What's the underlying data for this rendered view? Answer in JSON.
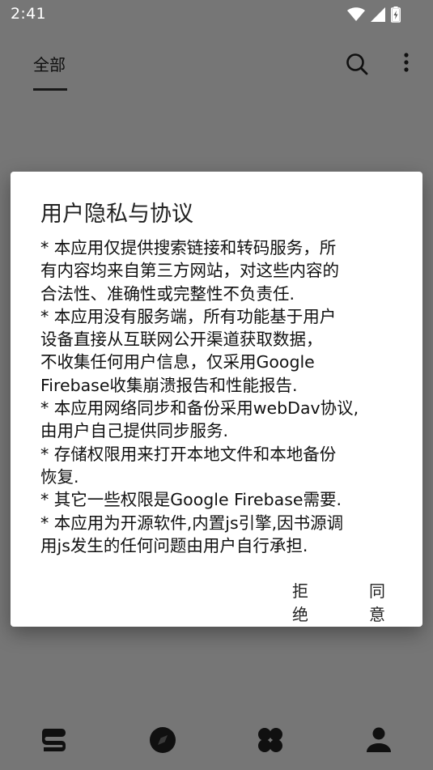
{
  "status_bar": {
    "time": "2:41",
    "icons": [
      "wifi-icon",
      "signal-icon",
      "battery-charging-icon"
    ]
  },
  "top_bar": {
    "tab_label": "全部",
    "icons": [
      "search-icon",
      "more-vert-icon"
    ]
  },
  "dialog": {
    "title": "用户隐私与协议",
    "lines": [
      "* 本应用仅提供搜索链接和转码服务，所",
      "有内容均来自第三方网站，对这些内容的",
      "合法性、准确性或完整性不负责任.",
      "* 本应用没有服务端，所有功能基于用户",
      "设备直接从互联网公开渠道获取数据，",
      "不收集任何用户信息，仅采用Google",
      "Firebase收集崩溃报告和性能报告.",
      "* 本应用网络同步和备份采用webDav协议,",
      "由用户自己提供同步服务.",
      "* 存储权限用来打开本地文件和本地备份",
      "恢复.",
      "* 其它一些权限是Google Firebase需要.",
      "* 本应用为开源软件,内置js引擎,因书源调",
      "用js发生的任何问题由用户自行承担."
    ],
    "reject_label": "拒绝",
    "agree_label": "同意"
  },
  "bottom_nav": {
    "items": [
      "bookshelf-icon",
      "explore-icon",
      "rss-icon",
      "profile-icon"
    ]
  },
  "colors": {
    "scrim": "#000000",
    "dialog_bg": "#ffffff",
    "text": "#222222"
  }
}
